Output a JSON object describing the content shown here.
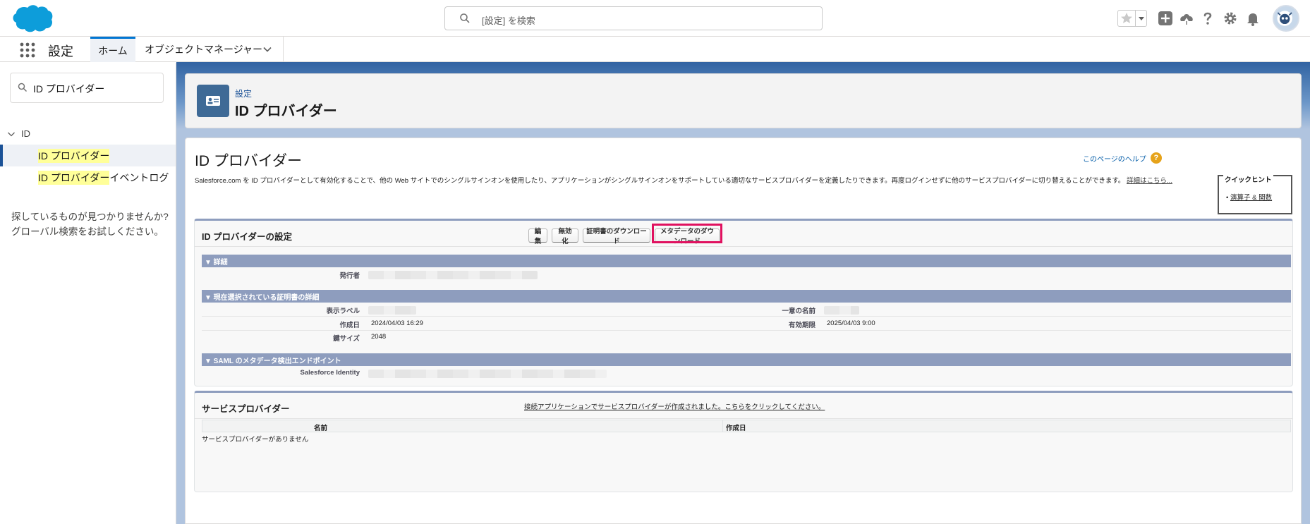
{
  "header": {
    "search_placeholder": "[設定] を検索",
    "icons": [
      "favorites-star-icon",
      "add-icon",
      "trailhead-icon",
      "help-icon",
      "setup-gear-icon",
      "notifications-bell-icon",
      "avatar"
    ]
  },
  "context_bar": {
    "app_name": "設定",
    "tabs": [
      {
        "label": "ホーム",
        "active": true
      },
      {
        "label": "オブジェクトマネージャー",
        "active": false
      }
    ]
  },
  "sidebar": {
    "quickfind_value": "ID プロバイダー",
    "tree_group": "ID",
    "items": [
      {
        "highlight": "ID プロバイダー",
        "rest": "",
        "selected": true
      },
      {
        "highlight": "ID プロバイダー",
        "rest": "イベントログ",
        "selected": false
      }
    ],
    "help_text": "探しているものが見つかりませんか? グローバル検索をお試しください。"
  },
  "page_header": {
    "breadcrumb": "設定",
    "title": "ID プロバイダー"
  },
  "content": {
    "title": "ID プロバイダー",
    "help_link": "このページのヘルプ",
    "description": "Salesforce.com を ID プロバイダーとして有効化することで、他の Web サイトでのシングルサインオンを使用したり、アプリケーションがシングルサインオンをサポートしている適切なサービスプロバイダーを定義したりできます。再度ログインせずに他のサービスプロバイダーに切り替えることができます。",
    "description_more": "詳細はこちら...",
    "quick_tips": {
      "title": "クイックヒント",
      "item": "演算子 & 関数"
    }
  },
  "idp_settings": {
    "title": "ID プロバイダーの設定",
    "buttons": {
      "edit": "編集",
      "disable": "無効化",
      "download_cert": "証明書のダウンロード",
      "download_metadata": "メタデータのダウンロード"
    },
    "sections": {
      "detail": {
        "heading": "▼ 詳細",
        "issuer_label": "発行者"
      },
      "cert": {
        "heading": "▼ 現在選択されている証明書の詳細",
        "label_label": "表示ラベル",
        "unique_name_label": "一意の名前",
        "created_label": "作成日",
        "created_value": "2024/04/03 16:29",
        "expires_label": "有効期限",
        "expires_value": "2025/04/03 9:00",
        "key_size_label": "鍵サイズ",
        "key_size_value": "2048"
      },
      "saml": {
        "heading": "▼ SAML のメタデータ検出エンドポイント",
        "identity_label": "Salesforce Identity"
      }
    }
  },
  "service_providers": {
    "title": "サービスプロバイダー",
    "link": "接続アプリケーションでサービスプロバイダーが作成されました。こちらをクリックしてください。",
    "columns": [
      "名前",
      "作成日"
    ],
    "empty": "サービスプロバイダーがありません"
  },
  "colors": {
    "brand_blue": "#0176d3",
    "header_band": "#1b5297",
    "section_head": "#8e9dbe",
    "highlight_box": "#e0115f",
    "search_highlight": "#ffff99"
  }
}
